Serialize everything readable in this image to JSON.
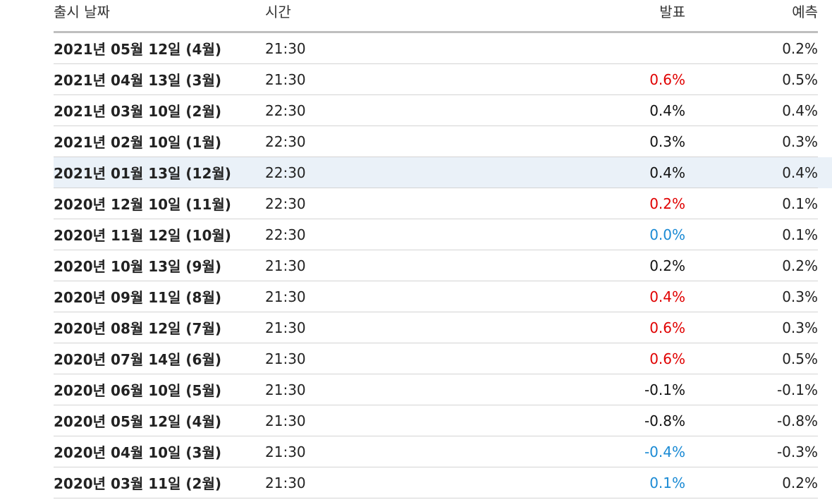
{
  "header": {
    "release_date": "출시 날짜",
    "time": "시간",
    "actual": "발표",
    "forecast": "예측"
  },
  "colors": {
    "up": "#e00000",
    "down": "#1a8ad4",
    "neutral": "#111111"
  },
  "rows": [
    {
      "date": "2021년 05월 12일 (4월)",
      "time": "21:30",
      "actual": "",
      "actual_tone": "neutral",
      "forecast": "0.2%"
    },
    {
      "date": "2021년 04월 13일 (3월)",
      "time": "21:30",
      "actual": "0.6%",
      "actual_tone": "up",
      "forecast": "0.5%"
    },
    {
      "date": "2021년 03월 10일 (2월)",
      "time": "22:30",
      "actual": "0.4%",
      "actual_tone": "neutral",
      "forecast": "0.4%"
    },
    {
      "date": "2021년 02월 10일 (1월)",
      "time": "22:30",
      "actual": "0.3%",
      "actual_tone": "neutral",
      "forecast": "0.3%"
    },
    {
      "date": "2021년 01월 13일 (12월)",
      "time": "22:30",
      "actual": "0.4%",
      "actual_tone": "neutral",
      "forecast": "0.4%",
      "highlight": true
    },
    {
      "date": "2020년 12월 10일 (11월)",
      "time": "22:30",
      "actual": "0.2%",
      "actual_tone": "up",
      "forecast": "0.1%"
    },
    {
      "date": "2020년 11월 12일 (10월)",
      "time": "22:30",
      "actual": "0.0%",
      "actual_tone": "down",
      "forecast": "0.1%"
    },
    {
      "date": "2020년 10월 13일 (9월)",
      "time": "21:30",
      "actual": "0.2%",
      "actual_tone": "neutral",
      "forecast": "0.2%"
    },
    {
      "date": "2020년 09월 11일 (8월)",
      "time": "21:30",
      "actual": "0.4%",
      "actual_tone": "up",
      "forecast": "0.3%"
    },
    {
      "date": "2020년 08월 12일 (7월)",
      "time": "21:30",
      "actual": "0.6%",
      "actual_tone": "up",
      "forecast": "0.3%"
    },
    {
      "date": "2020년 07월 14일 (6월)",
      "time": "21:30",
      "actual": "0.6%",
      "actual_tone": "up",
      "forecast": "0.5%"
    },
    {
      "date": "2020년 06월 10일 (5월)",
      "time": "21:30",
      "actual": "-0.1%",
      "actual_tone": "neutral",
      "forecast": "-0.1%"
    },
    {
      "date": "2020년 05월 12일 (4월)",
      "time": "21:30",
      "actual": "-0.8%",
      "actual_tone": "neutral",
      "forecast": "-0.8%"
    },
    {
      "date": "2020년 04월 10일 (3월)",
      "time": "21:30",
      "actual": "-0.4%",
      "actual_tone": "down",
      "forecast": "-0.3%"
    },
    {
      "date": "2020년 03월 11일 (2월)",
      "time": "21:30",
      "actual": "0.1%",
      "actual_tone": "down",
      "forecast": "0.2%"
    }
  ]
}
